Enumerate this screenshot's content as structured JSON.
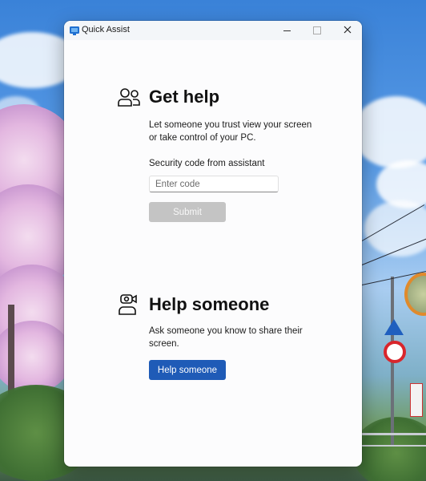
{
  "window": {
    "title": "Quick Assist"
  },
  "get_help": {
    "heading": "Get help",
    "description_line1": "Let someone you trust view your screen",
    "description_line2": "or take control of your PC.",
    "code_label": "Security code from assistant",
    "code_placeholder": "Enter code",
    "code_value": "",
    "submit_label": "Submit"
  },
  "help_someone": {
    "heading": "Help someone",
    "description_line1": "Ask someone you know to share their",
    "description_line2": "screen.",
    "button_label": "Help someone"
  },
  "colors": {
    "accent": "#1f5bb7",
    "disabled_button": "#c4c4c4",
    "window_bg": "#fcfcfd"
  },
  "icons": {
    "app": "quick-assist-icon",
    "get_help": "people-icon",
    "help_someone": "person-camera-icon"
  }
}
